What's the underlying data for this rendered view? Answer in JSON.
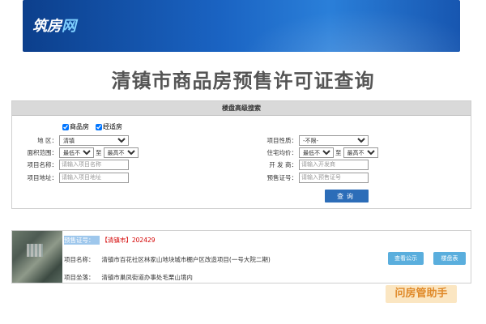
{
  "banner": {
    "logo_main": "筑房",
    "logo_accent": "网"
  },
  "page_title": "清镇市商品房预售许可证查询",
  "search": {
    "header": "楼盘高级搜索",
    "checkbox_1": "商品房",
    "checkbox_2": "经适房",
    "region_label": "地    区：",
    "region_value": "清镇",
    "area_label": "面积范围：",
    "area_min": "最低不限",
    "to_label": "至",
    "area_max": "最高不限",
    "name_label": "项目名称：",
    "name_placeholder": "请输入项目名称",
    "address_label": "项目地址：",
    "address_placeholder": "请输入项目地址",
    "type_label": "项目性质：",
    "type_value": "-不限-",
    "price_label": "住宅均价：",
    "price_min": "最低不限",
    "price_max": "最高不限",
    "developer_label": "开 发 商：",
    "developer_placeholder": "请输入开发商",
    "license_label": "预售证号：",
    "license_placeholder": "请输入预售证号",
    "query_button": "查询"
  },
  "result": {
    "license_label": "预售证号：",
    "license_value": "【清镇市】202429",
    "project_name_label": "项目名称：",
    "project_name": "清镇市百花社区林家山地块城市棚户区改造项目(一号大院二期)",
    "project_address_label": "项目坐落：",
    "project_address": "清镇市巢凤街道办事处毛栗山境内",
    "notice_button": "查看公示",
    "table_button": "楼盘表"
  },
  "watermark": "问房管助手"
}
